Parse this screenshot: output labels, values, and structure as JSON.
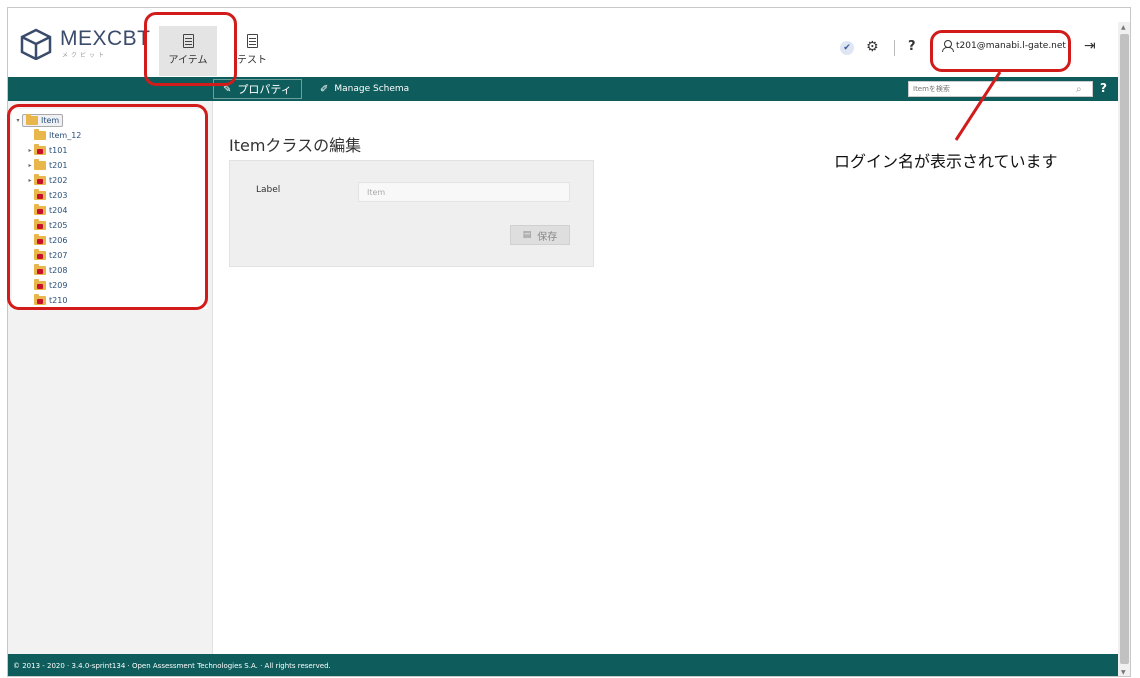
{
  "brand": {
    "name": "MEXCBT",
    "subtitle": "メクビット"
  },
  "nav": [
    {
      "label": "アイテム",
      "active": true
    },
    {
      "label": "テスト",
      "active": false
    }
  ],
  "header": {
    "user": "t201@manabi.l-gate.net",
    "help_icon": "?",
    "icons": [
      "check-icon",
      "gears-icon",
      "help-icon",
      "user-icon",
      "logout-icon"
    ]
  },
  "actionbar": {
    "properties_label": "プロパティ",
    "schema_label": "Manage Schema",
    "search_placeholder": "Itemを検索",
    "help": "?"
  },
  "tree": {
    "root": "Item",
    "items": [
      "Item_12",
      "t101",
      "t201",
      "t202",
      "t203",
      "t204",
      "t205",
      "t206",
      "t207",
      "t208",
      "t209",
      "t210"
    ]
  },
  "main": {
    "title": "Itemクラスの編集",
    "form": {
      "label": "Label",
      "value": "Item",
      "save_label": "保存"
    }
  },
  "footer": {
    "text": "© 2013 - 2020 · 3.4.0-sprint134 · Open Assessment Technologies S.A. · All rights reserved."
  },
  "annotation": {
    "note": "ログイン名が表示されています",
    "color": "#d21b1b"
  },
  "colors": {
    "teal": "#0e5d5c",
    "folder": "#e9b64c",
    "lock": "#c8102e"
  }
}
